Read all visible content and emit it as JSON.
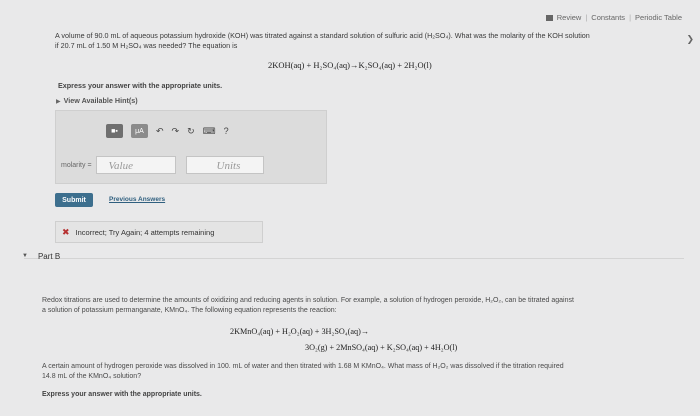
{
  "topbar": {
    "review_label": "Review",
    "constants_label": "Constants",
    "periodic_label": "Periodic Table",
    "sep": "|"
  },
  "question": {
    "text_line1": "A volume of 90.0 mL of aqueous potassium hydroxide (KOH) was titrated against a standard solution of sulfuric acid (H₂SO₄). What was the molarity of the KOH solution",
    "text_line2": "if 20.7 mL of 1.50 M H₂SO₄ was needed? The equation is",
    "equation": "2KOH(aq) + H₂SO₄(aq)→K₂SO₄(aq) + 2H₂O(l)",
    "instruction": "Express your answer with the appropriate units.",
    "hint_label": "View Available Hint(s)"
  },
  "answer": {
    "toolbar": {
      "template_label": "■▪",
      "mu_label": "μA",
      "undo": "↶",
      "redo": "↷",
      "reset": "↻",
      "keyboard": "⌨",
      "help": "?"
    },
    "label": "molarity =",
    "value_placeholder": "Value",
    "units_placeholder": "Units"
  },
  "actions": {
    "submit_label": "Submit",
    "previous_label": "Previous Answers"
  },
  "feedback": {
    "icon": "✖",
    "text": "Incorrect; Try Again; 4 attempts remaining"
  },
  "partB": {
    "toggle": "▼",
    "label": "Part B",
    "para_line1": "Redox titrations are used to determine the amounts of oxidizing and reducing agents in solution. For example, a solution of hydrogen peroxide, H₂O₂, can be titrated against",
    "para_line2": "a solution of potassium permanganate, KMnO₄. The following equation represents the reaction:",
    "eq_line1": "2KMnO₄(aq) + H₂O₂(aq) + 3H₂SO₄(aq)→",
    "eq_line2": "3O₂(g) + 2MnSO₄(aq) + K₂SO₄(aq) + 4H₂O(l)",
    "q_line1": "A certain amount of hydrogen peroxide was dissolved in 100. mL of water and then titrated with 1.68 M KMnO₄. What mass of H₂O₂ was dissolved if the titration required",
    "q_line2": "14.8 mL of the KMnO₄ solution?",
    "instruction": "Express your answer with the appropriate units."
  }
}
